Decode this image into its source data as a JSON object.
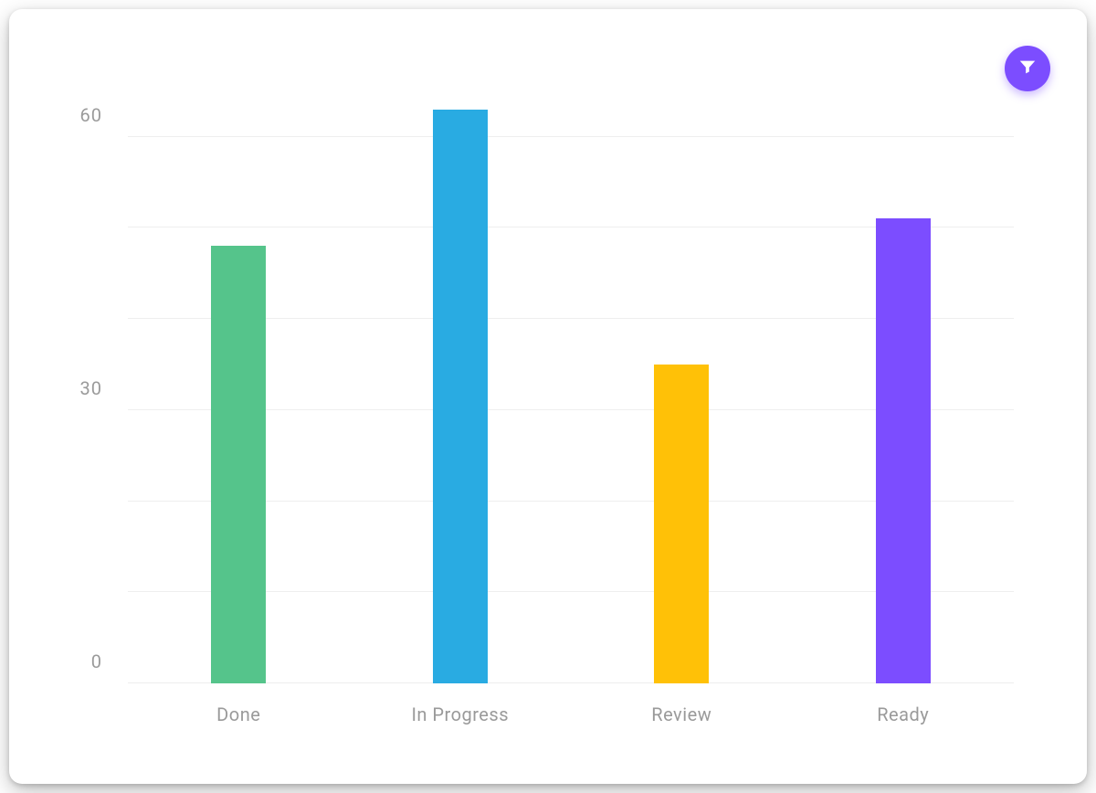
{
  "filter_button": {
    "icon": "filter-icon",
    "color": "#7C4DFF"
  },
  "chart_data": {
    "type": "bar",
    "categories": [
      "Done",
      "In Progress",
      "Review",
      "Ready"
    ],
    "values": [
      48,
      63,
      35,
      51
    ],
    "colors": [
      "#55C48B",
      "#29ABE2",
      "#FFC107",
      "#7C4DFF"
    ],
    "y_ticks": [
      0,
      30,
      60
    ],
    "minor_gridlines": [
      10,
      20,
      40,
      50
    ],
    "ylim": [
      0,
      70
    ],
    "xlabel": "",
    "ylabel": "",
    "title": ""
  }
}
